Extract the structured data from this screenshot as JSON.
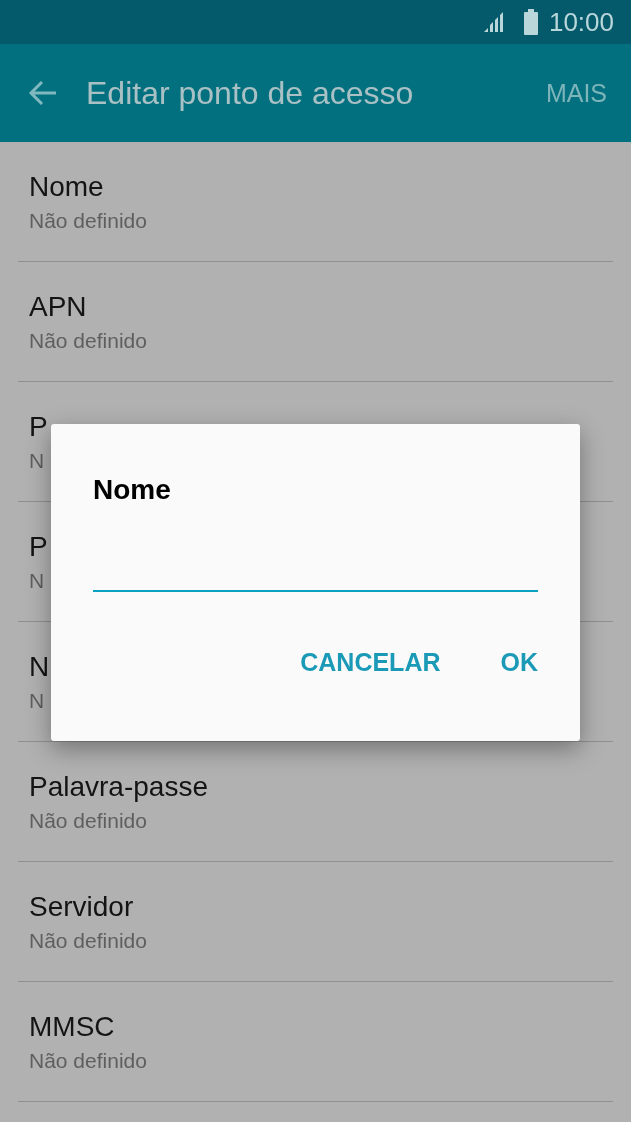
{
  "status_bar": {
    "time": "10:00"
  },
  "app_bar": {
    "title": "Editar ponto de acesso",
    "action": "MAIS"
  },
  "settings": [
    {
      "title": "Nome",
      "value": "Não definido"
    },
    {
      "title": "APN",
      "value": "Não definido"
    },
    {
      "title": "P",
      "value": "N"
    },
    {
      "title": "P",
      "value": "N"
    },
    {
      "title": "N",
      "value": "N"
    },
    {
      "title": "Palavra-passe",
      "value": "Não definido"
    },
    {
      "title": "Servidor",
      "value": "Não definido"
    },
    {
      "title": "MMSC",
      "value": "Não definido"
    }
  ],
  "dialog": {
    "title": "Nome",
    "buttons": [
      "CANCELAR",
      "OK"
    ]
  }
}
